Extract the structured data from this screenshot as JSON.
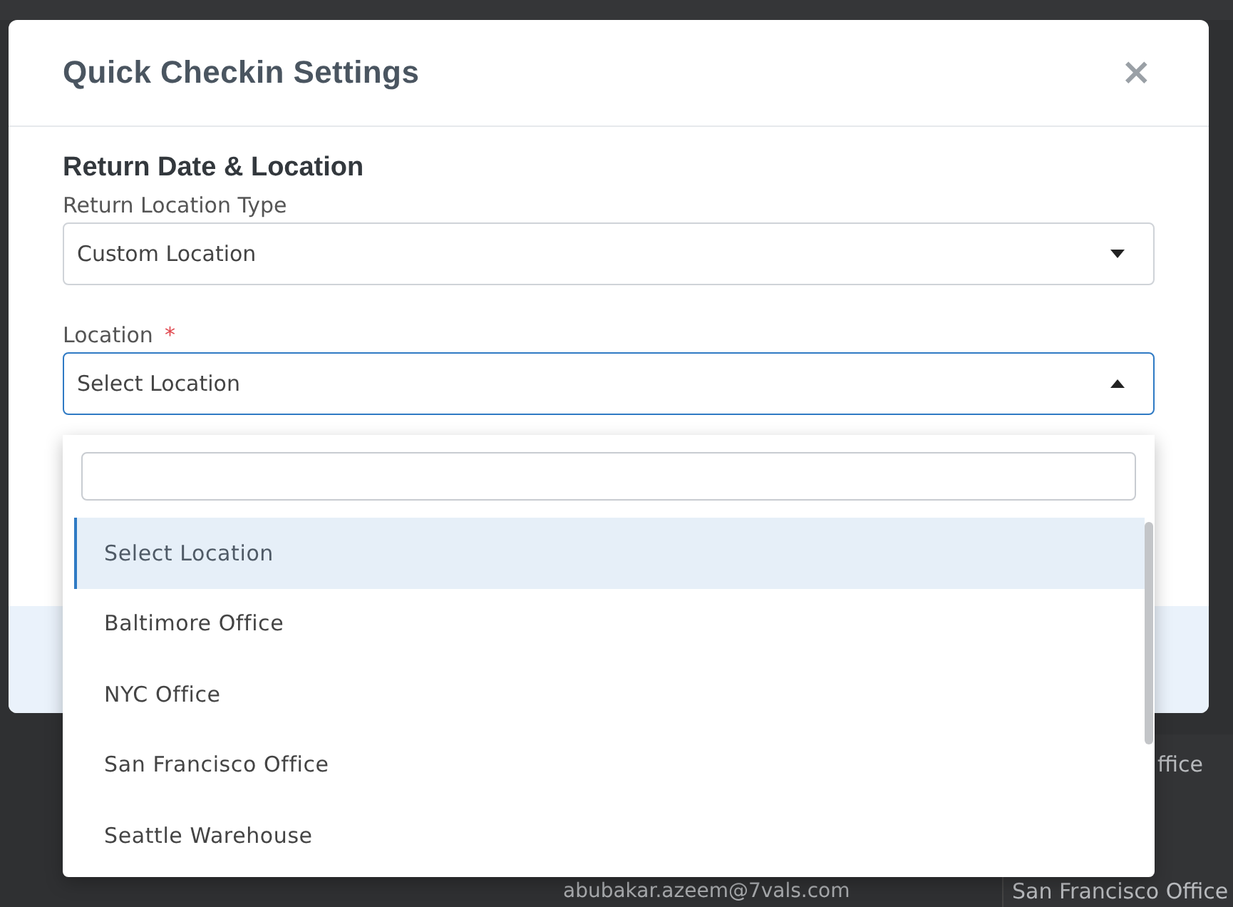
{
  "background": {
    "cells": [
      {
        "text": "ffice"
      },
      {
        "text": "San Francisco Office"
      }
    ],
    "email": "abubakar.azeem@7vals.com"
  },
  "dialog": {
    "title": "Quick Checkin Settings",
    "close": "×",
    "section_title": "Return Date & Location",
    "fields": [
      {
        "label": "Return Location Type",
        "value": "Custom Location",
        "expanded": false
      },
      {
        "label": "Location",
        "required_mark": "*",
        "value": "Select Location",
        "expanded": true
      }
    ]
  },
  "dropdown": {
    "options": [
      {
        "label": "Select Location",
        "selected": true
      },
      {
        "label": "Baltimore Office",
        "selected": false
      },
      {
        "label": "NYC Office",
        "selected": false
      },
      {
        "label": "San Francisco Office",
        "selected": false
      },
      {
        "label": "Seattle Warehouse",
        "selected": false
      }
    ]
  }
}
